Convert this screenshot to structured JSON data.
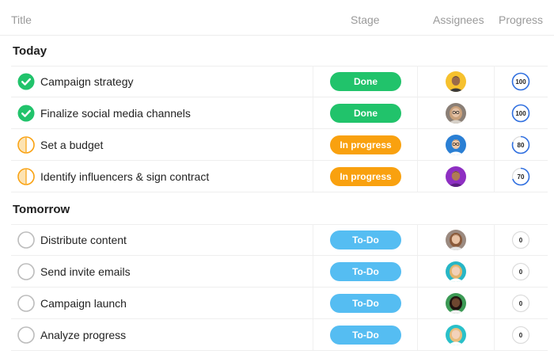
{
  "columns": {
    "title": "Title",
    "stage": "Stage",
    "assignees": "Assignees",
    "progress": "Progress"
  },
  "colors": {
    "done": "#21c36b",
    "in_progress": "#f9a10f",
    "todo": "#55bdf2",
    "ring": "#2f6fe0"
  },
  "groups": [
    {
      "name": "Today",
      "tasks": [
        {
          "title": "Campaign strategy",
          "status": "done",
          "stage": "Done",
          "progress": 100,
          "progress_label": "100",
          "avatar": "man-yellow-shirt"
        },
        {
          "title": "Finalize social media channels",
          "status": "done",
          "stage": "Done",
          "progress": 100,
          "progress_label": "100",
          "avatar": "woman-glasses"
        },
        {
          "title": "Set a budget",
          "status": "in_progress",
          "stage": "In progress",
          "progress": 80,
          "progress_label": "80",
          "avatar": "man-glasses-blue"
        },
        {
          "title": "Identify influencers & sign contract",
          "status": "in_progress",
          "stage": "In progress",
          "progress": 70,
          "progress_label": "70",
          "avatar": "man-purple"
        }
      ]
    },
    {
      "name": "Tomorrow",
      "tasks": [
        {
          "title": "Distribute content",
          "status": "todo",
          "stage": "To-Do",
          "progress": 0,
          "progress_label": "0",
          "avatar": "woman-brown-hair"
        },
        {
          "title": "Send invite emails",
          "status": "todo",
          "stage": "To-Do",
          "progress": 0,
          "progress_label": "0",
          "avatar": "woman-teal"
        },
        {
          "title": "Campaign launch",
          "status": "todo",
          "stage": "To-Do",
          "progress": 0,
          "progress_label": "0",
          "avatar": "woman-curly-green"
        },
        {
          "title": "Analyze progress",
          "status": "todo",
          "stage": "To-Do",
          "progress": 0,
          "progress_label": "0",
          "avatar": "woman-teal-2"
        }
      ]
    }
  ]
}
